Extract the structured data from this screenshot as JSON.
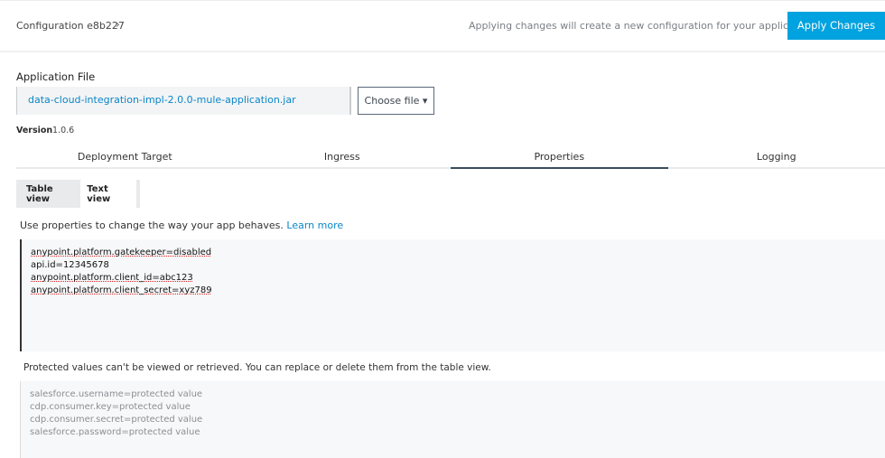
{
  "header": {
    "breadcrumb": "Configuration e8b227",
    "chevron": "›",
    "hint": "Applying changes will create a new configuration for your application",
    "apply_label": "Apply Changes"
  },
  "app_file": {
    "label": "Application File",
    "file_name": "data-cloud-integration-impl-2.0.0-mule-application.jar",
    "choose_label": "Choose file ▾",
    "version_label": "Version",
    "version_value": "1.0.6"
  },
  "tabs": [
    {
      "label": "Deployment Target"
    },
    {
      "label": "Ingress"
    },
    {
      "label": "Properties",
      "active": true
    },
    {
      "label": "Logging"
    }
  ],
  "view_toggle": {
    "table": "Table view",
    "text": "Text view",
    "selected": "Text view"
  },
  "properties": {
    "info": "Use properties to change the way your app behaves.",
    "learn_more": "Learn more",
    "lines": [
      "anypoint.platform.gatekeeper=disabled",
      "api.id=12345678",
      "anypoint.platform.client_id=abc123",
      "anypoint.platform.client_secret=xyz789"
    ],
    "protected_note": "Protected values can't be viewed or retrieved. You can replace or delete them from the table view.",
    "protected_lines": [
      "salesforce.username=protected value",
      "cdp.consumer.key=protected value",
      "cdp.consumer.secret=protected value",
      "salesforce.password=protected value"
    ]
  },
  "colors": {
    "accent": "#00a2df",
    "link": "#0a86c9"
  }
}
